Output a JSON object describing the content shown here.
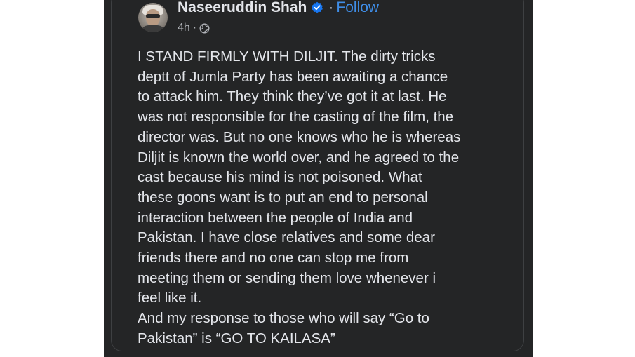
{
  "post": {
    "author": {
      "name": "Naseeruddin Shah",
      "avatar_icon": "profile-photo",
      "verified_icon": "verified-badge-icon"
    },
    "separator": "·",
    "follow_label": "Follow",
    "timestamp": "4h",
    "meta_separator": "·",
    "audience_icon": "globe-icon",
    "body_lines": [
      "I STAND FIRMLY WITH DILJIT. The dirty tricks",
      "deptt of Jumla Party has been awaiting a chance",
      "to attack him. They think they’ve got it at last. He",
      "was not responsible for the casting of the film, the",
      "director was. But no one knows who he is whereas",
      "Diljit is known the world over, and he agreed to the",
      "cast because his mind is not poisoned. What",
      "these goons want is to put an end to personal",
      "interaction between the people of India and",
      "Pakistan. I have close relatives and some dear",
      "friends there and no one can stop me from",
      "meeting them or sending them love whenever i",
      "feel like it.",
      "And my response to  those who will say “Go to",
      "Pakistan” is “GO TO KAILASA”"
    ]
  },
  "colors": {
    "background": "#242526",
    "text": "#e4e6eb",
    "secondary_text": "#b0b3b8",
    "link": "#3f8de6",
    "verified": "#1877f2"
  }
}
